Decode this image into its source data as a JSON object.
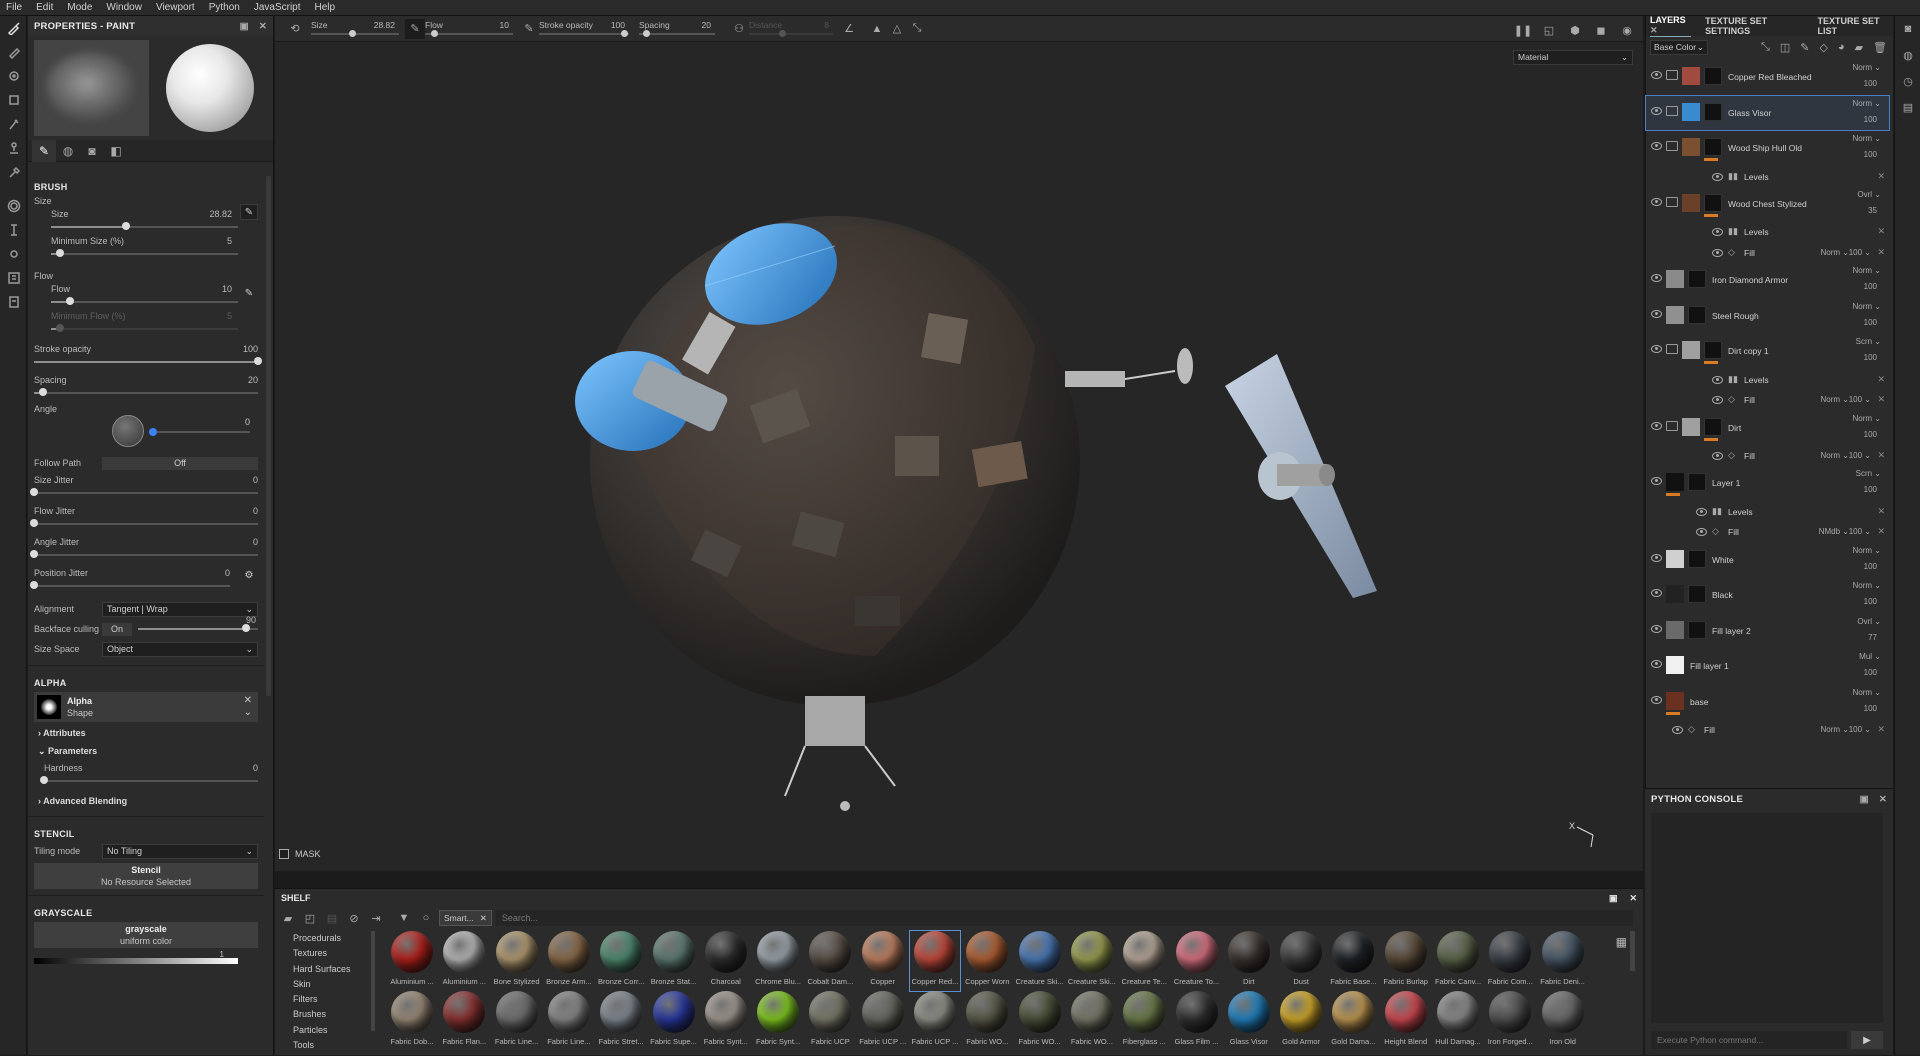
{
  "menu": [
    "File",
    "Edit",
    "Mode",
    "Window",
    "Viewport",
    "Python",
    "JavaScript",
    "Help"
  ],
  "props": {
    "title": "PROPERTIES - PAINT",
    "brush_section": "BRUSH",
    "size_group": "Size",
    "size_label": "Size",
    "size_value": "28.82",
    "size_frac": 0.4,
    "minsize_label": "Minimum Size (%)",
    "minsize_value": "5",
    "minsize_frac": 0.05,
    "flow_group": "Flow",
    "flow_label": "Flow",
    "flow_value": "10",
    "flow_frac": 0.1,
    "minflow_label": "Minimum Flow (%)",
    "minflow_value": "5",
    "minflow_frac": 0.05,
    "stroke_label": "Stroke opacity",
    "stroke_value": "100",
    "stroke_frac": 1.0,
    "spacing_label": "Spacing",
    "spacing_value": "20",
    "spacing_frac": 0.04,
    "angle_label": "Angle",
    "angle_value": "0",
    "followpath_label": "Follow Path",
    "followpath_value": "Off",
    "sizejitter_label": "Size Jitter",
    "sizejitter_value": "0",
    "flowjitter_label": "Flow Jitter",
    "flowjitter_value": "0",
    "anglejitter_label": "Angle Jitter",
    "anglejitter_value": "0",
    "posjitter_label": "Position Jitter",
    "posjitter_value": "0",
    "alignment_label": "Alignment",
    "alignment_value": "Tangent | Wrap",
    "backface_label": "Backface culling",
    "backface_toggle": "On",
    "backface_value": "90",
    "backface_frac": 0.9,
    "sizespace_label": "Size Space",
    "sizespace_value": "Object",
    "alpha_section": "ALPHA",
    "alpha_name": "Alpha",
    "alpha_type": "Shape",
    "attributes_label": "Attributes",
    "parameters_label": "Parameters",
    "hardness_label": "Hardness",
    "hardness_value": "0",
    "hardness_frac": 0.0,
    "advblend_label": "Advanced Blending",
    "stencil_section": "STENCIL",
    "tiling_label": "Tiling mode",
    "tiling_value": "No Tiling",
    "stencil_title": "Stencil",
    "stencil_sub": "No Resource Selected",
    "grayscale_section": "GRAYSCALE",
    "grayscale_title": "grayscale",
    "grayscale_sub": "uniform color",
    "grayscale_value": "1"
  },
  "ctx": {
    "size_label": "Size",
    "size_value": "28.82",
    "flow_label": "Flow",
    "flow_value": "10",
    "stroke_label": "Stroke opacity",
    "stroke_value": "100",
    "spacing_label": "Spacing",
    "spacing_value": "20",
    "distance_label": "Distance",
    "distance_value": "8",
    "material_mode": "Material"
  },
  "viewport": {
    "mask_label": "MASK",
    "axis_label": "X"
  },
  "shelf": {
    "title": "SHELF",
    "filter_chip": "Smart...",
    "search_placeholder": "Search...",
    "categories": [
      "Procedurals",
      "Textures",
      "Hard Surfaces",
      "Skin",
      "Filters",
      "Brushes",
      "Particles",
      "Tools"
    ],
    "row1": [
      {
        "n": "Aluminium ...",
        "c": "#b3201a"
      },
      {
        "n": "Aluminium ...",
        "c": "#b8b8b8"
      },
      {
        "n": "Bone Stylized",
        "c": "#b39a70"
      },
      {
        "n": "Bronze Arm...",
        "c": "#8a6a48"
      },
      {
        "n": "Bronze Corr...",
        "c": "#4e8a70"
      },
      {
        "n": "Bronze Stat...",
        "c": "#5d7a72"
      },
      {
        "n": "Charcoal",
        "c": "#2d2d2d"
      },
      {
        "n": "Chrome Blu...",
        "c": "#9aa4ac"
      },
      {
        "n": "Cobalt Dam...",
        "c": "#5a5048"
      },
      {
        "n": "Copper",
        "c": "#c08060"
      },
      {
        "n": "Copper Red...",
        "c": "#c2483a"
      },
      {
        "n": "Copper Worn",
        "c": "#b05e32"
      },
      {
        "n": "Creature Ski...",
        "c": "#4a78b8"
      },
      {
        "n": "Creature Ski...",
        "c": "#9aa050"
      },
      {
        "n": "Creature Te...",
        "c": "#b8a898"
      },
      {
        "n": "Creature To...",
        "c": "#d87080"
      },
      {
        "n": "Dirt",
        "c": "#3a322c"
      },
      {
        "n": "Dust",
        "c": "#3c3c3c"
      },
      {
        "n": "Fabric Base...",
        "c": "#202428"
      },
      {
        "n": "Fabric Burlap",
        "c": "#5a4a38"
      },
      {
        "n": "Fabric Canv...",
        "c": "#5a6448"
      },
      {
        "n": "Fabric Com...",
        "c": "#3a4048"
      },
      {
        "n": "Fabric Deni...",
        "c": "#485868"
      }
    ],
    "row2": [
      {
        "n": "Fabric Dob...",
        "c": "#9a8a78"
      },
      {
        "n": "Fabric Flan...",
        "c": "#8a3030"
      },
      {
        "n": "Fabric Line...",
        "c": "#707070"
      },
      {
        "n": "Fabric Line...",
        "c": "#888888"
      },
      {
        "n": "Fabric Stret...",
        "c": "#808890"
      },
      {
        "n": "Fabric Supe...",
        "c": "#2838a0"
      },
      {
        "n": "Fabric Synt...",
        "c": "#a09890"
      },
      {
        "n": "Fabric Synt...",
        "c": "#80c820"
      },
      {
        "n": "Fabric UCP",
        "c": "#787868"
      },
      {
        "n": "Fabric UCP ...",
        "c": "#686860"
      },
      {
        "n": "Fabric UCP ...",
        "c": "#909088"
      },
      {
        "n": "Fabric WO...",
        "c": "#585848"
      },
      {
        "n": "Fabric WO...",
        "c": "#4a5038"
      },
      {
        "n": "Fabric WO...",
        "c": "#787868"
      },
      {
        "n": "Fiberglass ...",
        "c": "#6a7a48"
      },
      {
        "n": "Glass Film ...",
        "c": "#303030"
      },
      {
        "n": "Glass Visor",
        "c": "#2080c0"
      },
      {
        "n": "Gold Armor",
        "c": "#d0a828"
      },
      {
        "n": "Gold Dama...",
        "c": "#c09850"
      },
      {
        "n": "Height Blend",
        "c": "#d04850"
      },
      {
        "n": "Hull Damag...",
        "c": "#8a8a8a"
      },
      {
        "n": "Iron Forged...",
        "c": "#505050"
      },
      {
        "n": "Iron Old",
        "c": "#6a6a6a"
      }
    ]
  },
  "layers": {
    "tabs": [
      "LAYERS",
      "TEXTURE SET SETTINGS",
      "TEXTURE SET LIST"
    ],
    "channel": "Base Color",
    "items": [
      {
        "type": "layer",
        "name": "Copper Red Bleached",
        "blend": "Norm",
        "opacity": "100",
        "folder": true,
        "c1": "#a04a40",
        "orange": false
      },
      {
        "type": "layer",
        "name": "Glass Visor",
        "blend": "Norm",
        "opacity": "100",
        "folder": true,
        "c1": "#3a8ad0",
        "orange": false,
        "sel": true
      },
      {
        "type": "layer",
        "name": "Wood Ship Hull Old",
        "blend": "Norm",
        "opacity": "100",
        "folder": true,
        "c1": "#7a5030",
        "orange": true
      },
      {
        "type": "sub",
        "name": "Levels",
        "indent": 1
      },
      {
        "type": "layer",
        "name": "Wood Chest Stylized",
        "blend": "Ovrl",
        "opacity": "35",
        "folder": true,
        "c1": "#6a4028",
        "orange": true
      },
      {
        "type": "sub",
        "name": "Levels",
        "indent": 1
      },
      {
        "type": "sub",
        "name": "Fill",
        "indent": 1,
        "blend": "Norm",
        "opacity": "100"
      },
      {
        "type": "layer",
        "name": "Iron Diamond Armor",
        "blend": "Norm",
        "opacity": "100",
        "folder": false,
        "c1": "#8a8a8a",
        "orange": false
      },
      {
        "type": "layer",
        "name": "Steel Rough",
        "blend": "Norm",
        "opacity": "100",
        "folder": false,
        "c1": "#909090",
        "orange": false
      },
      {
        "type": "layer",
        "name": "Dirt copy 1",
        "blend": "Scrn",
        "opacity": "100",
        "folder": true,
        "c1": "#a0a0a0",
        "orange": true
      },
      {
        "type": "sub",
        "name": "Levels",
        "indent": 1
      },
      {
        "type": "sub",
        "name": "Fill",
        "indent": 1,
        "blend": "Norm",
        "opacity": "100"
      },
      {
        "type": "layer",
        "name": "Dirt",
        "blend": "Norm",
        "opacity": "100",
        "folder": true,
        "c1": "#a0a0a0",
        "orange": true
      },
      {
        "type": "sub",
        "name": "Fill",
        "indent": 1,
        "blend": "Norm",
        "opacity": "100"
      },
      {
        "type": "layer",
        "name": "Layer 1",
        "blend": "Scrn",
        "opacity": "100",
        "folder": false,
        "c1": "#111111",
        "orange": true
      },
      {
        "type": "sub",
        "name": "Levels",
        "indent": 0
      },
      {
        "type": "sub",
        "name": "Fill",
        "indent": 0,
        "blend": "NMdb",
        "opacity": "100"
      },
      {
        "type": "layer",
        "name": "White",
        "blend": "Norm",
        "opacity": "100",
        "folder": false,
        "c1": "#d0d0d0",
        "orange": false
      },
      {
        "type": "layer",
        "name": "Black",
        "blend": "Norm",
        "opacity": "100",
        "folder": false,
        "c1": "#222222",
        "orange": false
      },
      {
        "type": "layer",
        "name": "Fill layer 2",
        "blend": "Ovrl",
        "opacity": "77",
        "folder": false,
        "c1": "#6a6a6a",
        "orange": false
      },
      {
        "type": "layer",
        "name": "Fill layer 1",
        "blend": "Mul",
        "opacity": "100",
        "folder": false,
        "c1": "#f0f0f0",
        "orange": false,
        "single": true
      },
      {
        "type": "layer",
        "name": "base",
        "blend": "Norm",
        "opacity": "100",
        "folder": false,
        "c1": "#6a3020",
        "orange": true,
        "single": true
      },
      {
        "type": "sub",
        "name": "Fill",
        "indent": -1,
        "blend": "Norm",
        "opacity": "100"
      }
    ]
  },
  "console": {
    "title": "PYTHON CONSOLE",
    "placeholder": "Execute Python command..."
  }
}
